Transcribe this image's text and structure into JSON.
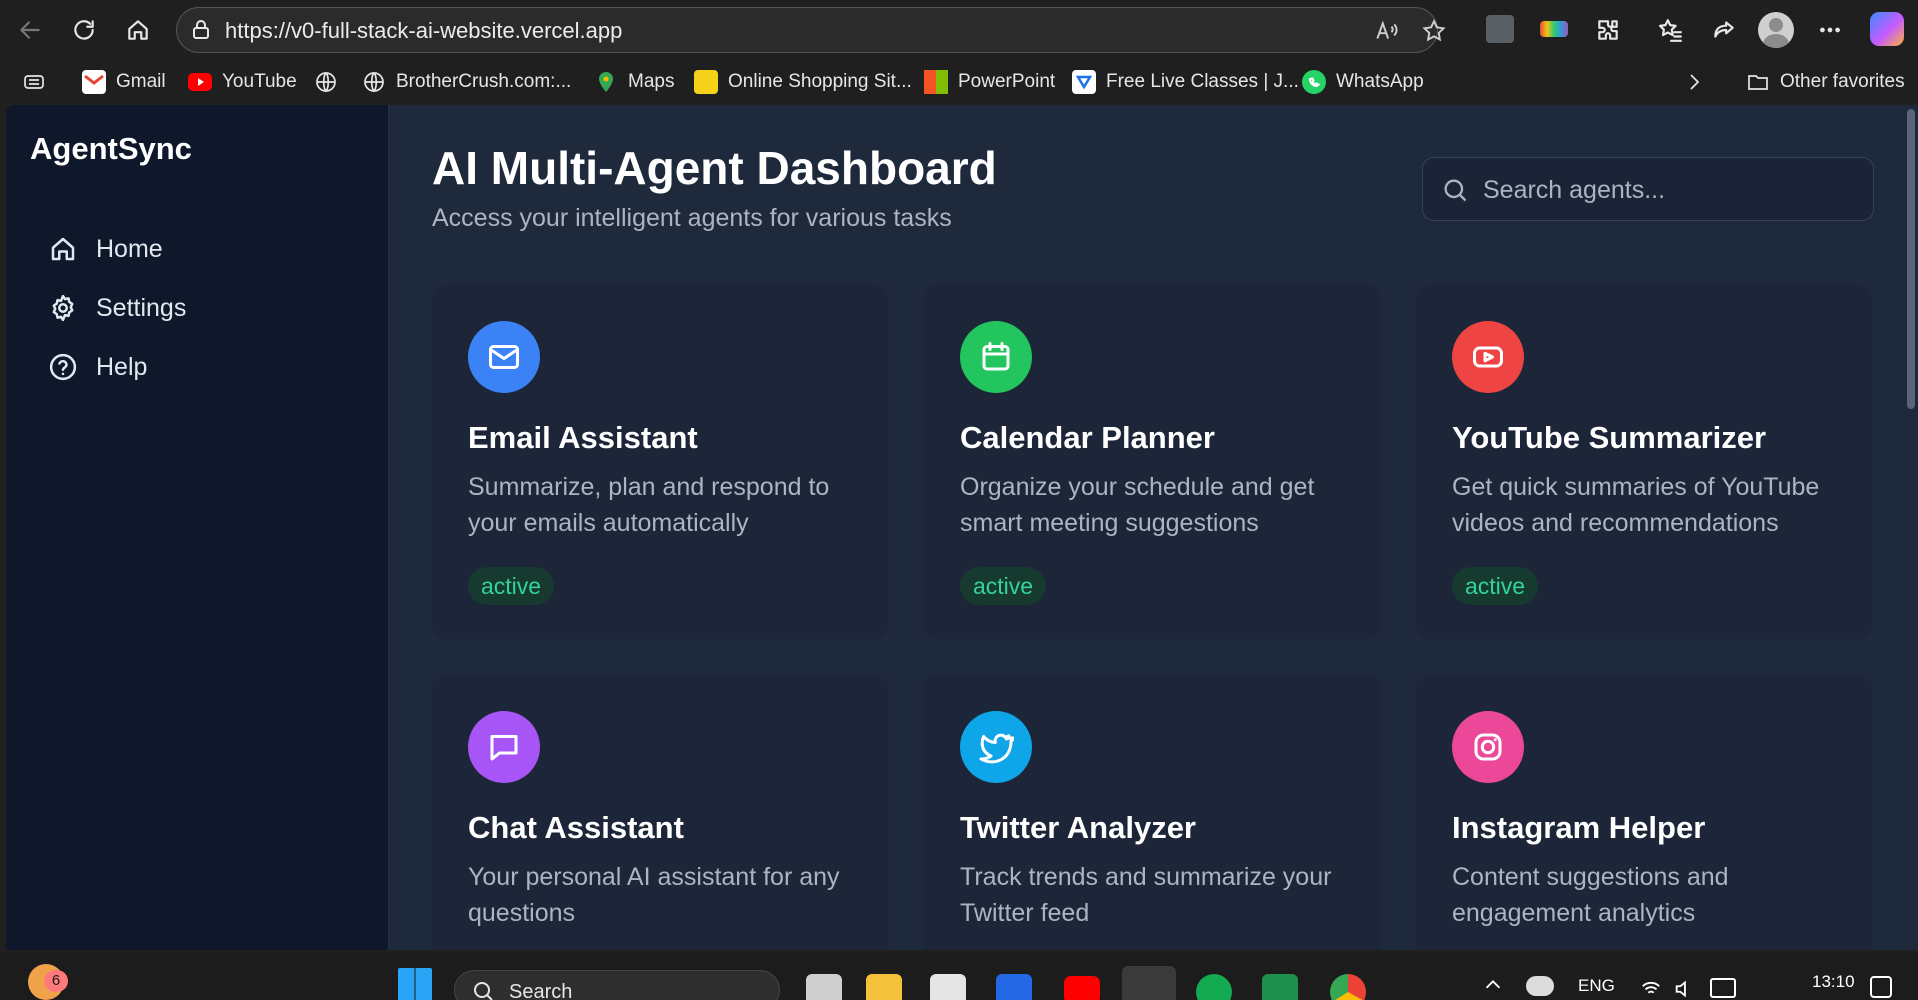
{
  "browser": {
    "url": "https://v0-full-stack-ai-website.vercel.app",
    "bookmarks": [
      {
        "label": "Gmail",
        "icon": "gmail-icon"
      },
      {
        "label": "YouTube",
        "icon": "youtube-icon"
      },
      {
        "label": "",
        "icon": "globe-icon"
      },
      {
        "label": "BrotherCrush.com:...",
        "icon": "globe-icon"
      },
      {
        "label": "Maps",
        "icon": "maps-icon"
      },
      {
        "label": "Online Shopping Sit...",
        "icon": "flipkart-icon"
      },
      {
        "label": "PowerPoint",
        "icon": "microsoft-icon"
      },
      {
        "label": "Free Live Classes | J...",
        "icon": "classes-icon"
      },
      {
        "label": "WhatsApp",
        "icon": "whatsapp-icon"
      }
    ],
    "other_favorites": "Other favorites"
  },
  "sidebar": {
    "brand": "AgentSync",
    "items": [
      {
        "label": "Home",
        "icon": "home-icon"
      },
      {
        "label": "Settings",
        "icon": "gear-icon"
      },
      {
        "label": "Help",
        "icon": "help-circle-icon"
      }
    ]
  },
  "header": {
    "title": "AI Multi-Agent Dashboard",
    "subtitle": "Access your intelligent agents for various tasks",
    "search_placeholder": "Search agents..."
  },
  "agents": [
    {
      "name": "Email Assistant",
      "description": "Summarize, plan and respond to your emails automatically",
      "status": "active",
      "icon": "mail-icon",
      "color": "#3b82f6"
    },
    {
      "name": "Calendar Planner",
      "description": "Organize your schedule and get smart meeting suggestions",
      "status": "active",
      "icon": "calendar-icon",
      "color": "#22c55e"
    },
    {
      "name": "YouTube Summarizer",
      "description": "Get quick summaries of YouTube videos and recommendations",
      "status": "active",
      "icon": "youtube-play-icon",
      "color": "#ef4444"
    },
    {
      "name": "Chat Assistant",
      "description": "Your personal AI assistant for any questions",
      "status": "",
      "icon": "message-icon",
      "color": "#a855f7"
    },
    {
      "name": "Twitter Analyzer",
      "description": "Track trends and summarize your Twitter feed",
      "status": "",
      "icon": "twitter-icon",
      "color": "#0ea5e9"
    },
    {
      "name": "Instagram Helper",
      "description": "Content suggestions and engagement analytics",
      "status": "",
      "icon": "instagram-icon",
      "color": "#ec4899"
    }
  ],
  "taskbar": {
    "notification_count": "6",
    "search_label": "Search",
    "language": "ENG",
    "time": "13:10"
  }
}
